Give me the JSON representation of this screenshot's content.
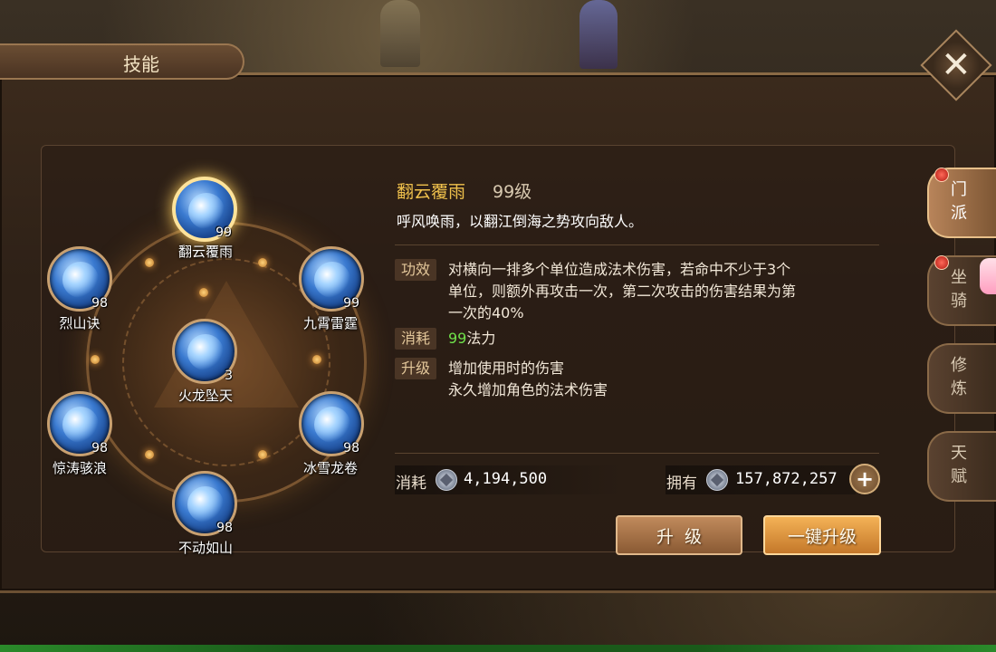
{
  "window": {
    "title": "技能",
    "close_label": "✕"
  },
  "skills": [
    {
      "name": "翻云覆雨",
      "level": "99",
      "active": true
    },
    {
      "name": "烈山诀",
      "level": "98"
    },
    {
      "name": "九霄雷霆",
      "level": "99"
    },
    {
      "name": "火龙坠天",
      "level": "3"
    },
    {
      "name": "惊涛骇浪",
      "level": "98"
    },
    {
      "name": "冰雪龙卷",
      "level": "98"
    },
    {
      "name": "不动如山",
      "level": "98"
    }
  ],
  "detail": {
    "name": "翻云覆雨",
    "level": "99级",
    "description": "呼风唤雨，以翻江倒海之势攻向敌人。",
    "effect_tag": "功效",
    "effect_lines": [
      "对横向一排多个单位造成法术伤害，若命中不少于3个",
      "单位，则额外再攻击一次，第二次攻击的伤害结果为第",
      "一次的40%"
    ],
    "cost_tag": "消耗",
    "cost_value": "99",
    "cost_unit": "法力",
    "upgrade_tag": "升级",
    "upgrade_lines": [
      "增加使用时的伤害",
      "永久增加角色的法术伤害"
    ]
  },
  "currency": {
    "cost_label": "消耗",
    "cost_amount": "4,194,500",
    "own_label": "拥有",
    "own_amount": "157,872,257",
    "add_label": "+"
  },
  "buttons": {
    "upgrade": "升级",
    "one_key_upgrade": "一键升级"
  },
  "side_tabs": [
    {
      "label": "门派",
      "active": true,
      "badge": true
    },
    {
      "label": "坐骑",
      "badge": true
    },
    {
      "label": "修炼"
    },
    {
      "label": "天赋"
    }
  ],
  "colors": {
    "accent_gold": "#f0c14c",
    "green_value": "#6fe04a"
  }
}
